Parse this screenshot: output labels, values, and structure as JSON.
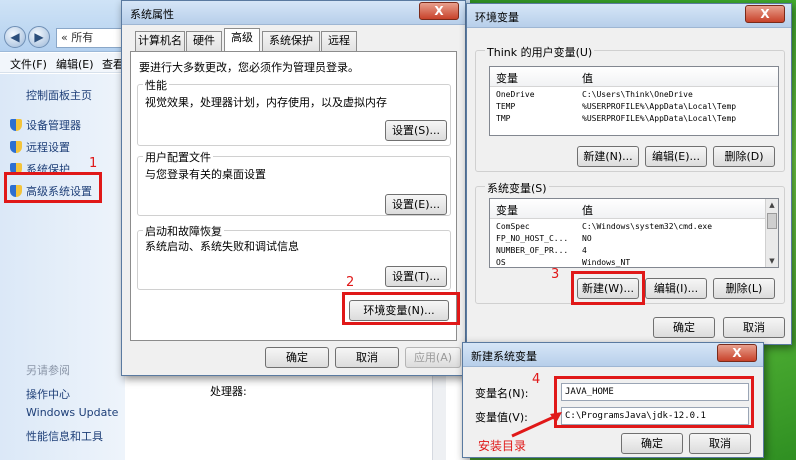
{
  "control_panel": {
    "address_text": "« 所有",
    "menu": {
      "file": "文件(F)",
      "edit": "编辑(E)",
      "view": "查看"
    },
    "sidebar": {
      "home": "控制面板主页",
      "device_manager": "设备管理器",
      "remote": "远程设置",
      "protection": "系统保护",
      "advanced": "高级系统设置",
      "see_also": "另请参阅",
      "action_center": "操作中心",
      "windows_update": "Windows Update",
      "perf_tools": "性能信息和工具"
    },
    "processor_label": "处理器:"
  },
  "sys_props": {
    "title": "系统属性",
    "close": "X",
    "tabs": [
      "计算机名",
      "硬件",
      "高级",
      "系统保护",
      "远程"
    ],
    "admin_note": "要进行大多数更改，您必须作为管理员登录。",
    "performance": {
      "title": "性能",
      "desc": "视觉效果，处理器计划，内存使用，以及虚拟内存",
      "button": "设置(S)..."
    },
    "user_profiles": {
      "title": "用户配置文件",
      "desc": "与您登录有关的桌面设置",
      "button": "设置(E)..."
    },
    "startup": {
      "title": "启动和故障恢复",
      "desc": "系统启动、系统失败和调试信息",
      "button": "设置(T)..."
    },
    "env_button": "环境变量(N)...",
    "ok": "确定",
    "cancel": "取消",
    "apply": "应用(A)"
  },
  "env_vars": {
    "title": "环境变量",
    "close": "X",
    "user_section": "Think 的用户变量(U)",
    "col_var": "变量",
    "col_val": "值",
    "user_rows": [
      {
        "name": "OneDrive",
        "value": "C:\\Users\\Think\\OneDrive"
      },
      {
        "name": "TEMP",
        "value": "%USERPROFILE%\\AppData\\Local\\Temp"
      },
      {
        "name": "TMP",
        "value": "%USERPROFILE%\\AppData\\Local\\Temp"
      }
    ],
    "user_new": "新建(N)...",
    "user_edit": "编辑(E)...",
    "user_delete": "删除(D)",
    "sys_section": "系统变量(S)",
    "sys_rows": [
      {
        "name": "ComSpec",
        "value": "C:\\Windows\\system32\\cmd.exe"
      },
      {
        "name": "FP_NO_HOST_C...",
        "value": "NO"
      },
      {
        "name": "NUMBER_OF_PR...",
        "value": "4"
      },
      {
        "name": "OS",
        "value": "Windows_NT"
      }
    ],
    "sys_new": "新建(W)...",
    "sys_edit": "编辑(I)...",
    "sys_delete": "删除(L)",
    "ok": "确定",
    "cancel": "取消"
  },
  "new_var": {
    "title": "新建系统变量",
    "close": "X",
    "name_label": "变量名(N):",
    "name_value": "JAVA_HOME",
    "value_label": "变量值(V):",
    "value_value": "C:\\ProgramsJava\\jdk-12.0.1",
    "ok": "确定",
    "cancel": "取消"
  },
  "annotations": {
    "step1": "1",
    "step2": "2",
    "step3": "3",
    "step4": "4",
    "install_dir": "安装目录"
  },
  "colors": {
    "annotation_red": "#e01818",
    "desktop_green": "#3aa52c"
  }
}
